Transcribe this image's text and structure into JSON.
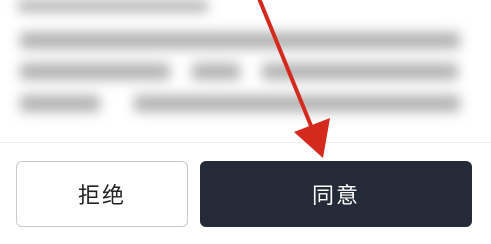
{
  "dialog": {
    "reject_label": "拒绝",
    "agree_label": "同意"
  },
  "colors": {
    "agree_background": "#252a38",
    "agree_text": "#ffffff",
    "reject_border": "#c9c9c9",
    "reject_text": "#222222",
    "annotation_arrow": "#d42a1e"
  },
  "icons": {
    "annotation": "red-arrow-icon"
  }
}
